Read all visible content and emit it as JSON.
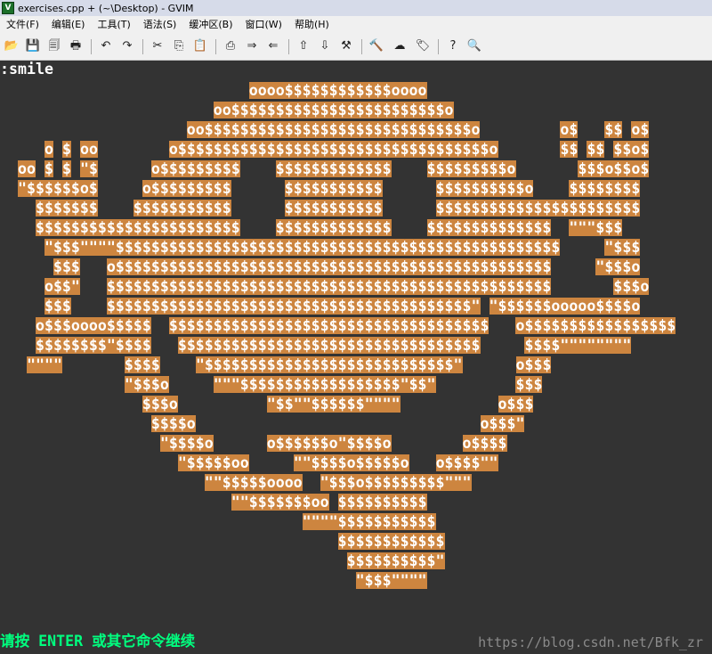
{
  "window": {
    "title": "exercises.cpp + (~\\Desktop) - GVIM"
  },
  "menubar": {
    "items": [
      "文件(F)",
      "编辑(E)",
      "工具(T)",
      "语法(S)",
      "缓冲区(B)",
      "窗口(W)",
      "帮助(H)"
    ]
  },
  "toolbar": {
    "buttons": [
      {
        "name": "open-icon",
        "glyph": "📂"
      },
      {
        "name": "save-icon",
        "glyph": "💾"
      },
      {
        "name": "save-all-icon",
        "glyph": "🗐"
      },
      {
        "name": "print-icon",
        "glyph": "🖶"
      },
      {
        "name": "undo-icon",
        "glyph": "↶"
      },
      {
        "name": "redo-icon",
        "glyph": "↷"
      },
      {
        "name": "cut-icon",
        "glyph": "✂"
      },
      {
        "name": "copy-icon",
        "glyph": "⎘"
      },
      {
        "name": "paste-icon",
        "glyph": "📋"
      },
      {
        "name": "find-replace-icon",
        "glyph": "⎙"
      },
      {
        "name": "find-next-icon",
        "glyph": "⇒"
      },
      {
        "name": "find-prev-icon",
        "glyph": "⇐"
      },
      {
        "name": "load-session-icon",
        "glyph": "⇧"
      },
      {
        "name": "save-session-icon",
        "glyph": "⇩"
      },
      {
        "name": "run-script-icon",
        "glyph": "⚒"
      },
      {
        "name": "make-icon",
        "glyph": "🔨"
      },
      {
        "name": "shell-icon",
        "glyph": "☁"
      },
      {
        "name": "tags-icon",
        "glyph": "🏷"
      },
      {
        "name": "help-icon",
        "glyph": "?"
      },
      {
        "name": "search-help-icon",
        "glyph": "🔍"
      }
    ]
  },
  "editor": {
    "command": ":smile",
    "art_lines": [
      "                            oooo$$$$$$$$$$$$oooo",
      "                        oo$$$$$$$$$$$$$$$$$$$$$$$$o",
      "                     oo$$$$$$$$$$$$$$$$$$$$$$$$$$$$$$o         o$   $$ o$",
      "     o $ oo        o$$$$$$$$$$$$$$$$$$$$$$$$$$$$$$$$$$$o       $$ $$ $$o$",
      "  oo $ $ \"$      o$$$$$$$$$    $$$$$$$$$$$$$    $$$$$$$$$o       $$$o$$o$",
      "  \"$$$$$$o$     o$$$$$$$$$      $$$$$$$$$$$      $$$$$$$$$$o    $$$$$$$$",
      "    $$$$$$$    $$$$$$$$$$$      $$$$$$$$$$$      $$$$$$$$$$$$$$$$$$$$$$$",
      "    $$$$$$$$$$$$$$$$$$$$$$$    $$$$$$$$$$$$$    $$$$$$$$$$$$$$  \"\"\"$$$",
      "     \"$$$\"\"\"\"$$$$$$$$$$$$$$$$$$$$$$$$$$$$$$$$$$$$$$$$$$$$$$$$$$     \"$$$",
      "      $$$   o$$$$$$$$$$$$$$$$$$$$$$$$$$$$$$$$$$$$$$$$$$$$$$$$$     \"$$$o",
      "     o$$\"   $$$$$$$$$$$$$$$$$$$$$$$$$$$$$$$$$$$$$$$$$$$$$$$$$$       $$$o",
      "     $$$    $$$$$$$$$$$$$$$$$$$$$$$$$$$$$$$$$$$$$$$$$\" \"$$$$$$ooooo$$$$o",
      "    o$$$oooo$$$$$  $$$$$$$$$$$$$$$$$$$$$$$$$$$$$$$$$$$$   o$$$$$$$$$$$$$$$$$",
      "    $$$$$$$$\"$$$$   $$$$$$$$$$$$$$$$$$$$$$$$$$$$$$$$$$     $$$$\"\"\"\"\"\"\"\"",
      "   \"\"\"\"       $$$$    \"$$$$$$$$$$$$$$$$$$$$$$$$$$$$\"      o$$$",
      "              \"$$$o     \"\"\"$$$$$$$$$$$$$$$$$$\"$$\"         $$$",
      "                $$$o          \"$$\"\"$$$$$$\"\"\"\"           o$$$",
      "                 $$$$o                                o$$$\"",
      "                  \"$$$$o      o$$$$$$o\"$$$$o        o$$$$",
      "                    \"$$$$$oo     \"\"$$$$o$$$$$o   o$$$$\"\"",
      "                       \"\"$$$$$oooo  \"$$$o$$$$$$$$$\"\"\"",
      "                          \"\"$$$$$$$oo $$$$$$$$$$",
      "                                  \"\"\"\"$$$$$$$$$$$",
      "                                      $$$$$$$$$$$$",
      "                                       $$$$$$$$$$\"",
      "                                        \"$$$\"\"\"\""
    ],
    "message": "请按 ENTER 或其它命令继续"
  },
  "watermark": "https://blog.csdn.net/Bfk_zr"
}
